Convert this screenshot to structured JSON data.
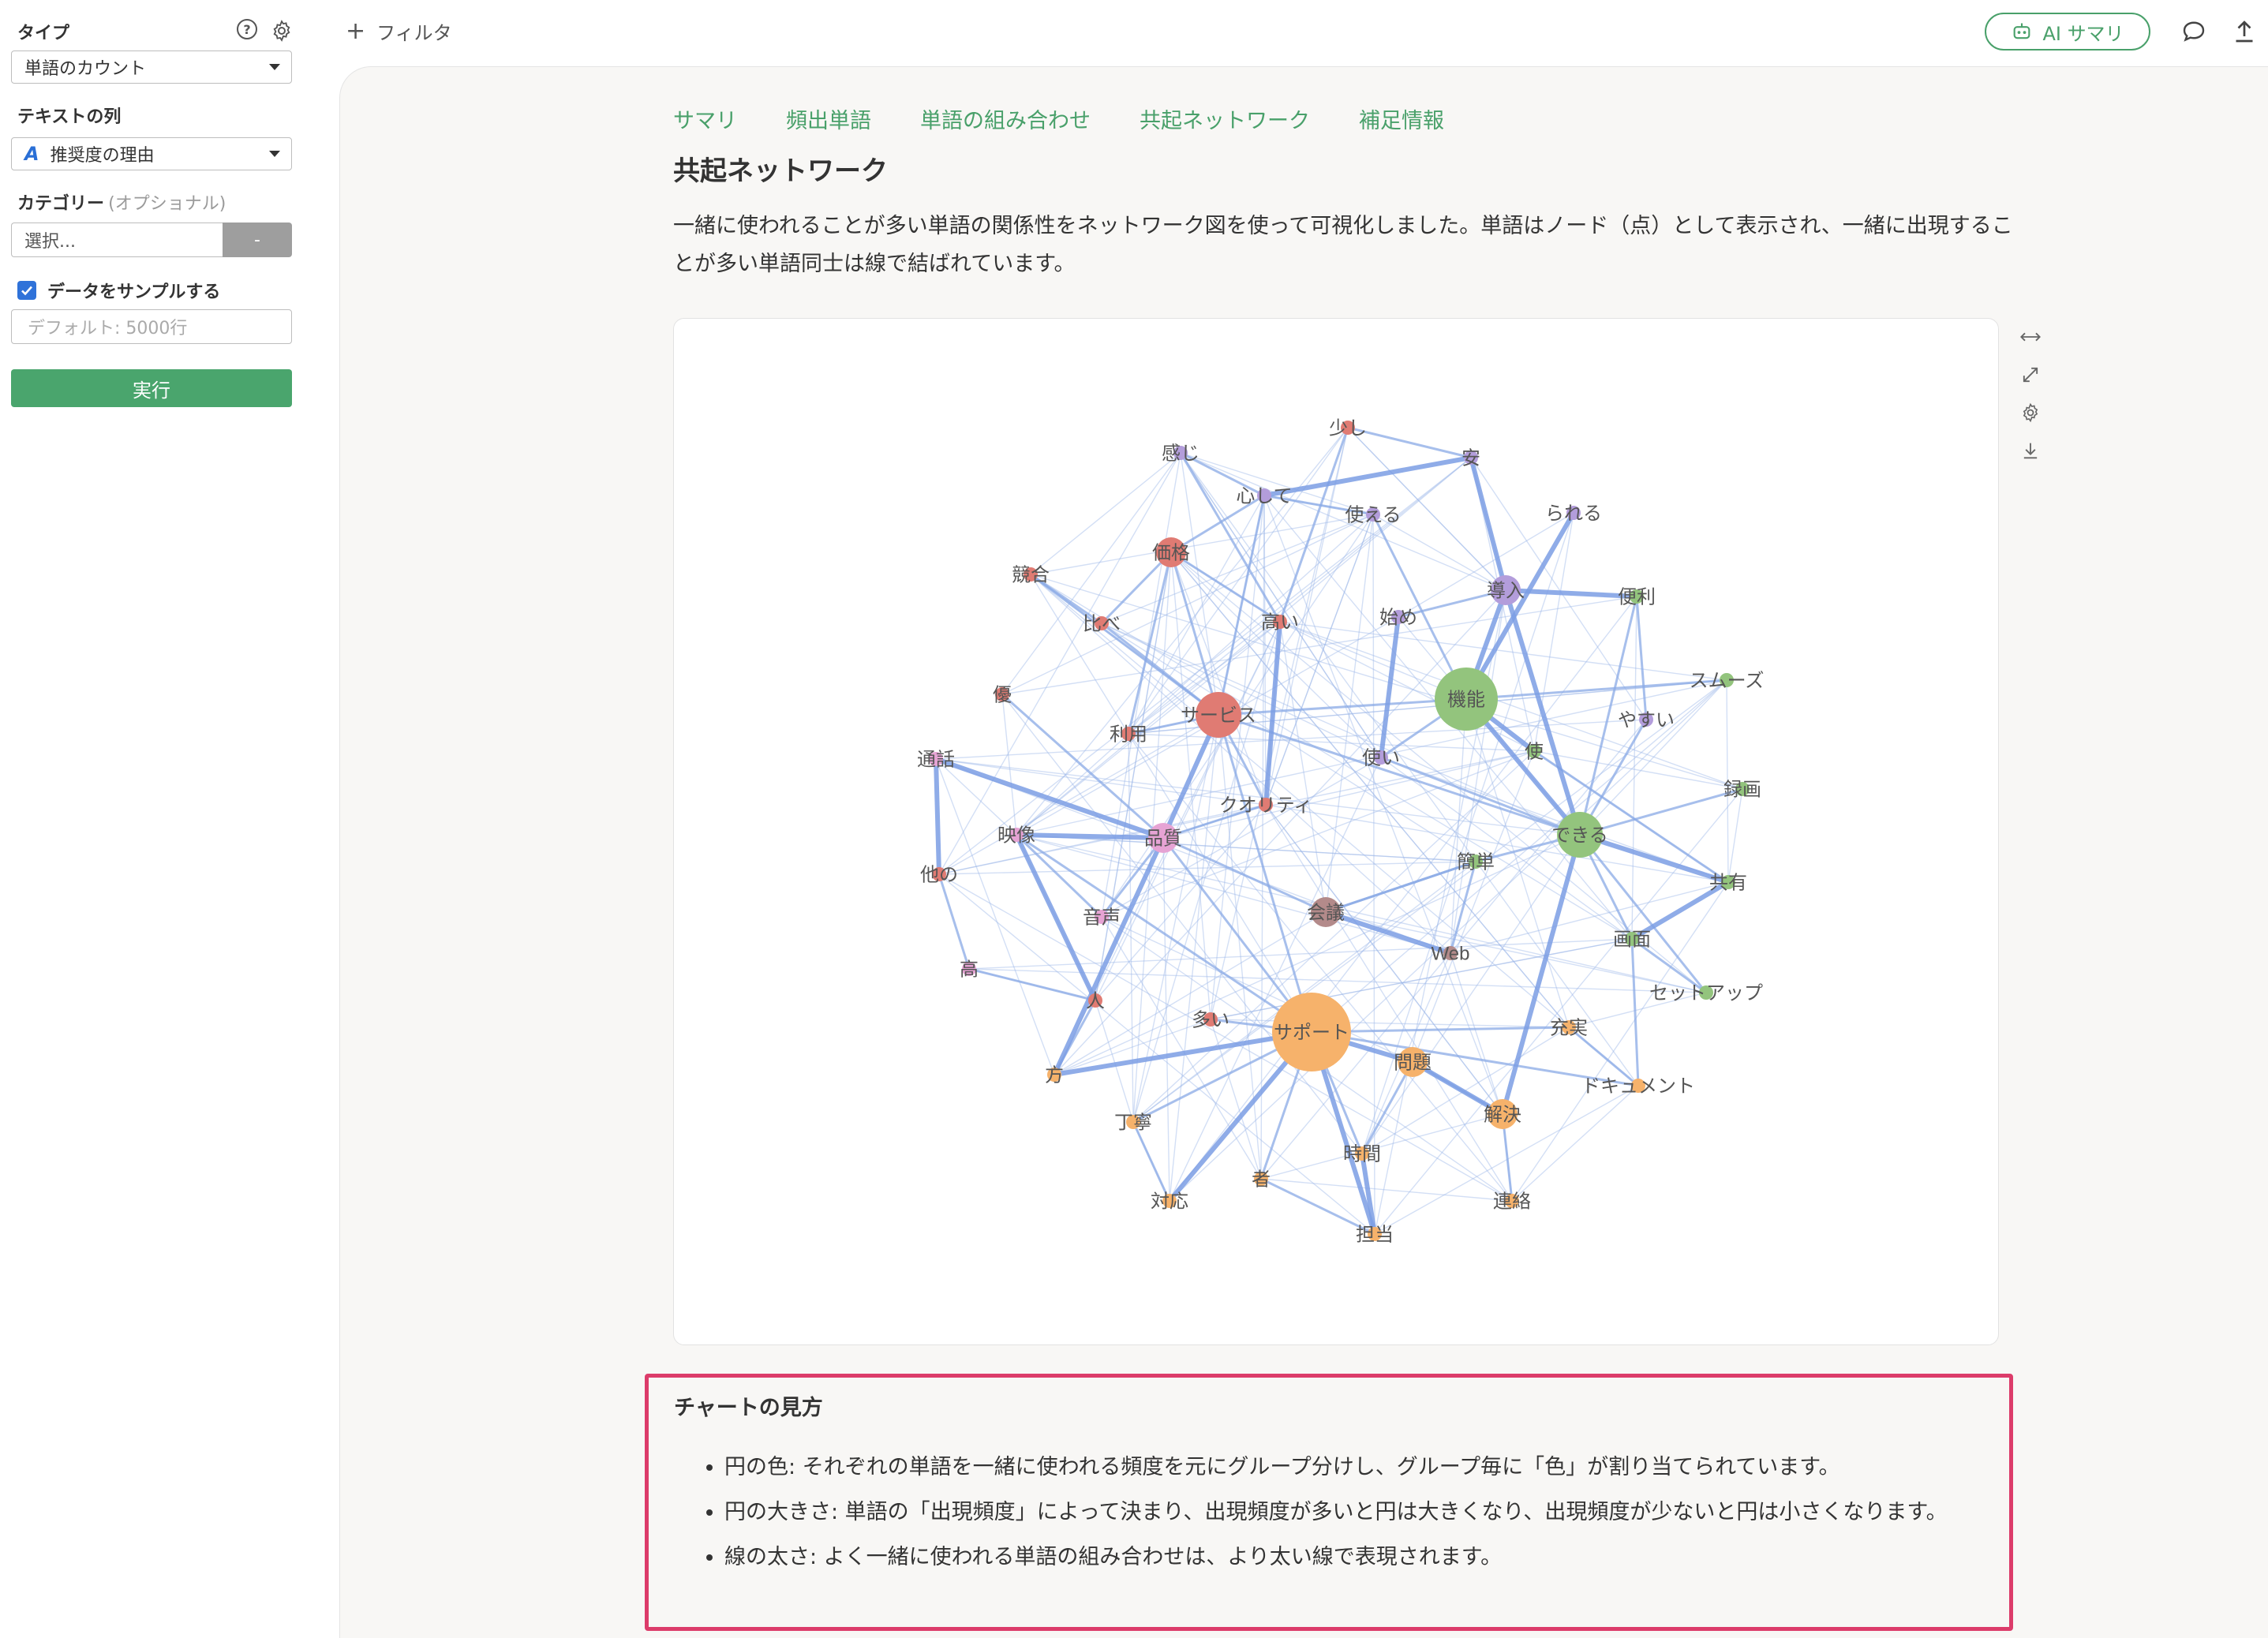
{
  "sidebar": {
    "type_label": "タイプ",
    "type_value": "単語のカウント",
    "text_col_label": "テキストの列",
    "text_col_type_icon": "A",
    "text_col_value": "推奨度の理由",
    "category_label": "カテゴリー",
    "category_optional": "(オプショナル)",
    "category_placeholder": "選択...",
    "category_clear": "-",
    "sample_label": "データをサンプルする",
    "sample_checked": true,
    "sample_placeholder": "デフォルト: 5000行",
    "run_label": "実行",
    "icons": [
      "help-icon",
      "gear-icon"
    ]
  },
  "topbar": {
    "filter_label": "フィルタ",
    "ai_summary_label": "AI サマリ",
    "icons": [
      "plus-icon",
      "robot-icon",
      "comment-icon",
      "upload-icon"
    ],
    "accent": "#49a06a"
  },
  "tabs": [
    "サマリ",
    "頻出単語",
    "単語の組み合わせ",
    "共起ネットワーク",
    "補足情報"
  ],
  "page": {
    "title": "共起ネットワーク",
    "description": "一緒に使われることが多い単語の関係性をネットワーク図を使って可視化しました。単語はノード（点）として表示され、一緒に出現することが多い単語同士は線で結ばれています。"
  },
  "chart_tools": [
    "expand-horizontal-icon",
    "fullscreen-icon",
    "gear-icon",
    "download-icon"
  ],
  "chart_data": {
    "type": "network",
    "groups": {
      "red": "#e07b73",
      "green": "#93c47d",
      "purple": "#b39ddb",
      "orange": "#f6b26b",
      "pink": "#e6a3d4",
      "brown": "#b38a8a"
    },
    "nodes": [
      {
        "id": "少し",
        "group": "red",
        "size": 1
      },
      {
        "id": "感じ",
        "group": "purple",
        "size": 1
      },
      {
        "id": "安",
        "group": "purple",
        "size": 1
      },
      {
        "id": "心して",
        "group": "purple",
        "size": 1
      },
      {
        "id": "使える",
        "group": "purple",
        "size": 1
      },
      {
        "id": "られる",
        "group": "purple",
        "size": 1
      },
      {
        "id": "価格",
        "group": "red",
        "size": 3
      },
      {
        "id": "競合",
        "group": "red",
        "size": 1
      },
      {
        "id": "導入",
        "group": "purple",
        "size": 3
      },
      {
        "id": "便利",
        "group": "green",
        "size": 1
      },
      {
        "id": "比べ",
        "group": "red",
        "size": 1
      },
      {
        "id": "高い",
        "group": "red",
        "size": 1
      },
      {
        "id": "始め",
        "group": "purple",
        "size": 1
      },
      {
        "id": "スムーズ",
        "group": "green",
        "size": 1
      },
      {
        "id": "機能",
        "group": "green",
        "size": 6
      },
      {
        "id": "優",
        "group": "red",
        "size": 1
      },
      {
        "id": "サービス",
        "group": "red",
        "size": 4
      },
      {
        "id": "利用",
        "group": "red",
        "size": 1
      },
      {
        "id": "やすい",
        "group": "purple",
        "size": 1
      },
      {
        "id": "使い",
        "group": "purple",
        "size": 1
      },
      {
        "id": "使",
        "group": "green",
        "size": 1
      },
      {
        "id": "通話",
        "group": "pink",
        "size": 1
      },
      {
        "id": "クオリティ",
        "group": "red",
        "size": 1
      },
      {
        "id": "録画",
        "group": "green",
        "size": 1
      },
      {
        "id": "映像",
        "group": "pink",
        "size": 1
      },
      {
        "id": "品質",
        "group": "pink",
        "size": 3
      },
      {
        "id": "できる",
        "group": "green",
        "size": 4
      },
      {
        "id": "他の",
        "group": "red",
        "size": 1
      },
      {
        "id": "簡単",
        "group": "green",
        "size": 1
      },
      {
        "id": "共有",
        "group": "green",
        "size": 1
      },
      {
        "id": "音声",
        "group": "pink",
        "size": 1
      },
      {
        "id": "会議",
        "group": "brown",
        "size": 3
      },
      {
        "id": "画面",
        "group": "green",
        "size": 1
      },
      {
        "id": "Web",
        "group": "brown",
        "size": 1
      },
      {
        "id": "高",
        "group": "pink",
        "size": 1
      },
      {
        "id": "セットアップ",
        "group": "green",
        "size": 1
      },
      {
        "id": "人",
        "group": "red",
        "size": 1
      },
      {
        "id": "多い",
        "group": "red",
        "size": 1
      },
      {
        "id": "サポート",
        "group": "orange",
        "size": 10
      },
      {
        "id": "充実",
        "group": "orange",
        "size": 1
      },
      {
        "id": "問題",
        "group": "orange",
        "size": 3
      },
      {
        "id": "方",
        "group": "orange",
        "size": 1
      },
      {
        "id": "ドキュメント",
        "group": "orange",
        "size": 1
      },
      {
        "id": "解決",
        "group": "orange",
        "size": 3
      },
      {
        "id": "丁寧",
        "group": "orange",
        "size": 1
      },
      {
        "id": "時間",
        "group": "orange",
        "size": 1
      },
      {
        "id": "者",
        "group": "orange",
        "size": 1
      },
      {
        "id": "対応",
        "group": "orange",
        "size": 1
      },
      {
        "id": "連絡",
        "group": "orange",
        "size": 1
      },
      {
        "id": "担当",
        "group": "orange",
        "size": 1
      }
    ]
  },
  "guide": {
    "title": "チャートの見方",
    "items": [
      "円の色: それぞれの単語を一緒に使われる頻度を元にグループ分けし、グループ毎に「色」が割り当てられています。",
      "円の大きさ: 単語の「出現頻度」によって決まり、出現頻度が多いと円は大きくなり、出現頻度が少ないと円は小さくなります。",
      "線の太さ: よく一緒に使われる単語の組み合わせは、より太い線で表現されます。"
    ]
  }
}
